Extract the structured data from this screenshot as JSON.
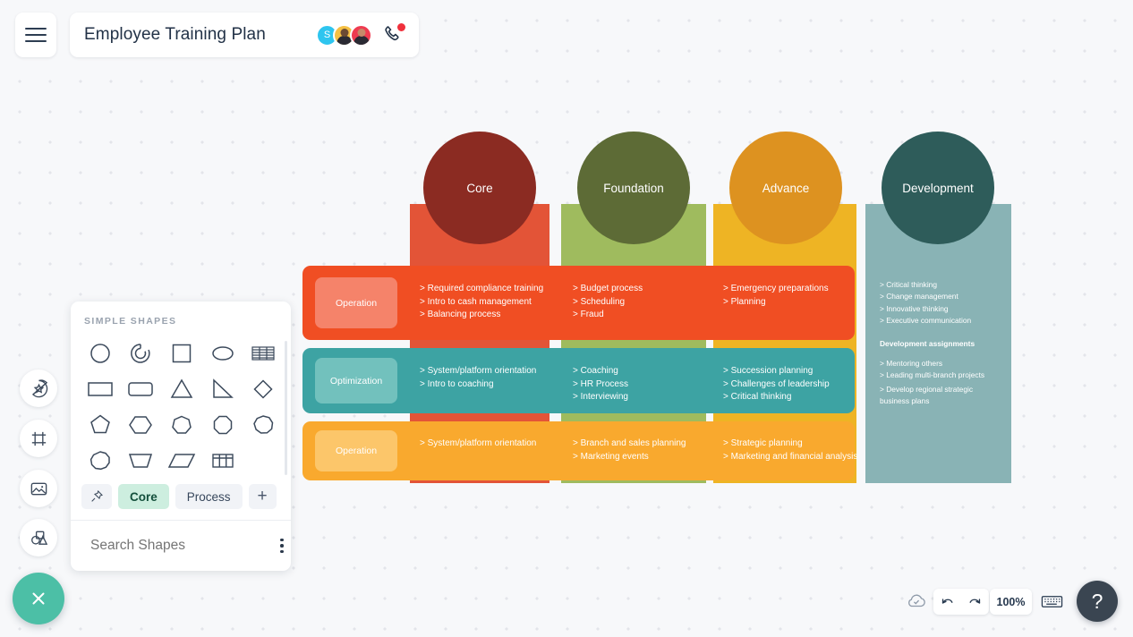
{
  "header": {
    "title": "Employee Training Plan",
    "menu_icon": "hamburger-menu-icon",
    "phone_icon": "phone-call-icon",
    "avatars": [
      {
        "initial": "S",
        "color": "#2ec5ef"
      },
      {
        "initial": "",
        "color": "#f5c044"
      },
      {
        "initial": "",
        "color": "#ef3b50"
      }
    ]
  },
  "left_rail": {
    "items": [
      {
        "icon": "sticker-star-icon"
      },
      {
        "icon": "frame-icon"
      },
      {
        "icon": "image-icon"
      },
      {
        "icon": "shapes-icon"
      }
    ],
    "close_button": {
      "icon": "close-x-icon",
      "color": "#4cbfa6"
    }
  },
  "shapes_panel": {
    "heading": "SIMPLE SHAPES",
    "shapes": [
      "circle-shape",
      "arc-shape",
      "square-shape",
      "ellipse-shape",
      "lined-table-shape",
      "rectangle-shape",
      "rounded-rectangle-shape",
      "triangle-shape",
      "right-triangle-shape",
      "diamond-shape",
      "pentagon-shape",
      "hexagon-shape",
      "heptagon-shape",
      "octagon-shape",
      "nonagon-shape",
      "decagon-shape",
      "trapezoid-shape",
      "parallelogram-shape",
      "table-grid-shape"
    ],
    "tabs": [
      {
        "label": "",
        "icon": "pin-icon",
        "active": false
      },
      {
        "label": "Core",
        "active": true
      },
      {
        "label": "Process",
        "active": false
      },
      {
        "label": "+",
        "icon": "plus-icon",
        "active": false
      }
    ],
    "search": {
      "placeholder": "Search Shapes",
      "value": "",
      "icon": "search-icon"
    },
    "more_icon": "kebab-menu-icon"
  },
  "chart_data": {
    "type": "table",
    "title": "Employee Training Plan",
    "columns": [
      {
        "label": "Core",
        "circle_color": "#8b2b22",
        "strip_color": "#e35437"
      },
      {
        "label": "Foundation",
        "circle_color": "#5d6b36",
        "strip_color": "#9fbb5e"
      },
      {
        "label": "Advance",
        "circle_color": "#dd9220",
        "strip_color": "#eeb424"
      },
      {
        "label": "Development",
        "circle_color": "#2e5c5a",
        "strip_color": "#89b3b5"
      }
    ],
    "rows": [
      {
        "label": "Operation",
        "color": "#f04e23",
        "label_color": "#f5836a",
        "cells": [
          [
            "> Required compliance training",
            "> Intro to cash management",
            "> Balancing process"
          ],
          [
            "> Budget process",
            "> Scheduling",
            "> Fraud"
          ],
          [
            "> Emergency preparations",
            "> Planning"
          ]
        ]
      },
      {
        "label": "Optimization",
        "color": "#3da3a3",
        "label_color": "#72c1bd",
        "cells": [
          [
            "> System/platform orientation",
            "> Intro to coaching"
          ],
          [
            "> Coaching",
            "> HR Process",
            "> Interviewing"
          ],
          [
            "> Succession planning",
            "> Challenges of leadership",
            "> Critical thinking"
          ]
        ]
      },
      {
        "label": "Operation",
        "color": "#f9a92e",
        "label_color": "#fcc66a",
        "cells": [
          [
            "> System/platform orientation"
          ],
          [
            "> Branch and sales planning",
            "> Marketing events"
          ],
          [
            "> Strategic planning",
            "> Marketing and financial analysis"
          ]
        ]
      }
    ],
    "development_column": {
      "items": [
        "> Critical thinking",
        "> Change management",
        "> Innovative thinking",
        "> Executive communication"
      ],
      "subheading": "Development assignments",
      "assignments": [
        "> Mentoring others",
        "> Leading multi-branch projects",
        "> Develop regional strategic business plans"
      ]
    }
  },
  "bottom_bar": {
    "cloud_icon": "cloud-saved-icon",
    "undo_icon": "undo-icon",
    "redo_icon": "redo-icon",
    "zoom_level": "100%",
    "keyboard_icon": "keyboard-icon",
    "help_label": "?"
  }
}
